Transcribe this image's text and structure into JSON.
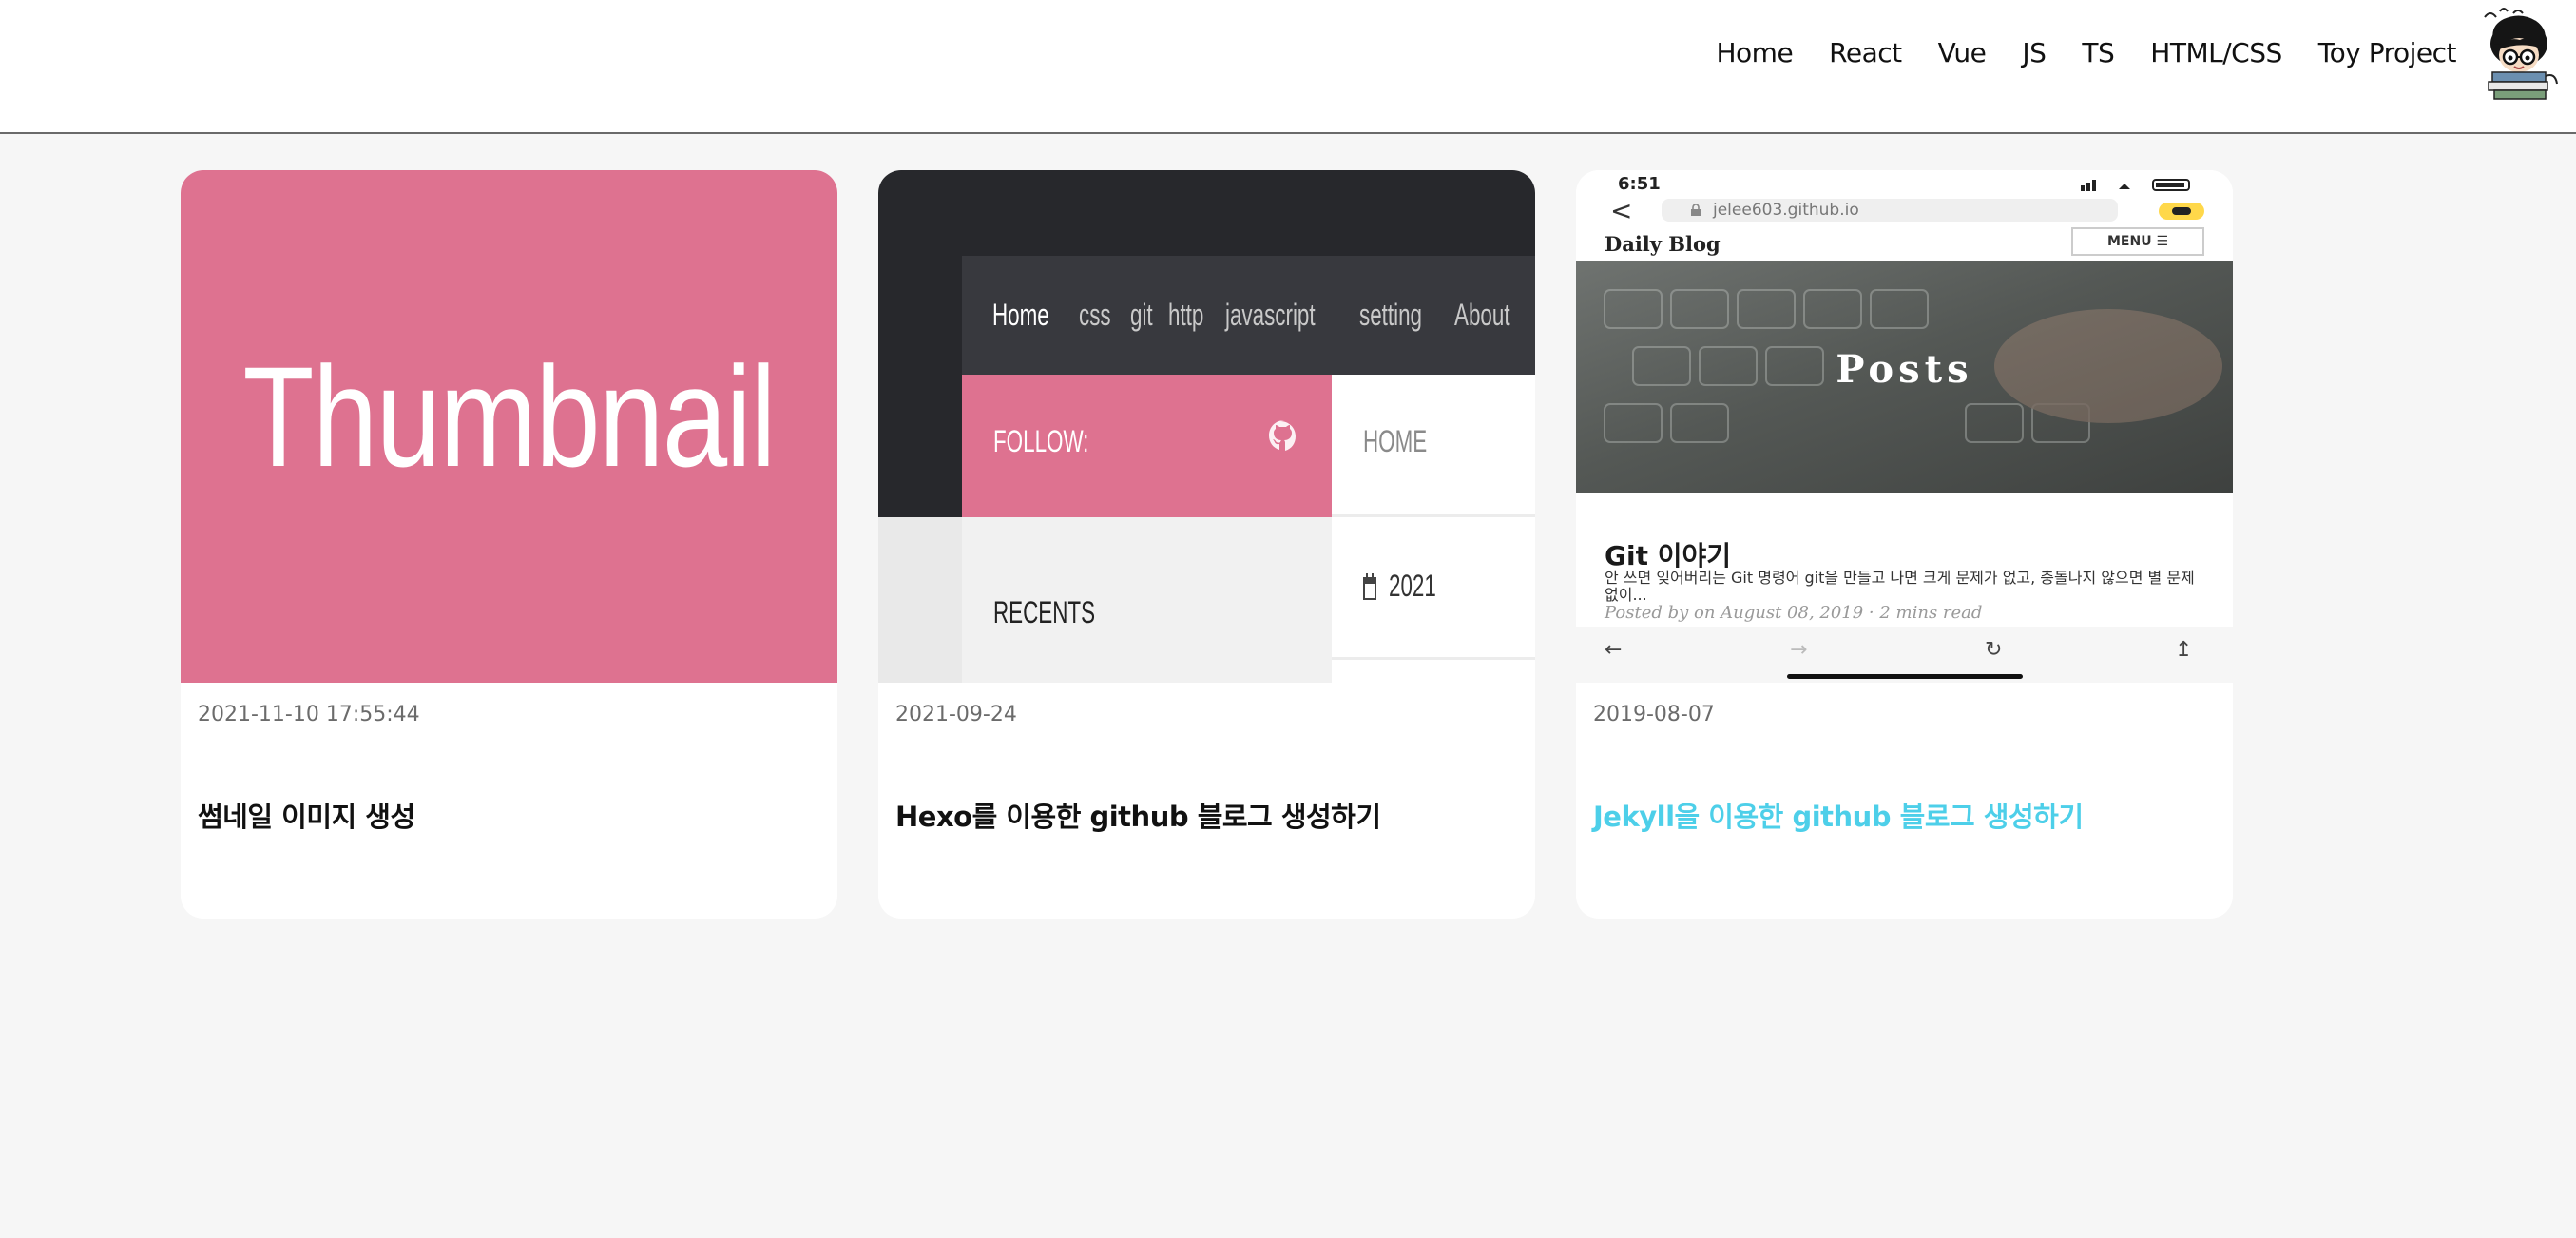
{
  "header": {
    "nav": [
      "Home",
      "React",
      "Vue",
      "JS",
      "TS",
      "HTML/CSS",
      "Toy Project"
    ],
    "avatar_icon": "cartoon-avatar-icon"
  },
  "accent_color": "#4dcfe9",
  "cards": [
    {
      "date": "2021-11-10 17:55:44",
      "title": "썸네일 이미지 생성",
      "thumbnail": {
        "background": "#de7290",
        "text": "Thumbnail"
      }
    },
    {
      "date": "2021-09-24",
      "title": "Hexo를 이용한 github 블로그 생성하기",
      "thumbnail": {
        "nav": [
          "Home",
          "css",
          "git",
          "http",
          "javascript",
          "setting",
          "About"
        ],
        "follow_label": "FOLLOW:",
        "home_label": "HOME",
        "recents_label": "RECENTS",
        "year_label": "2021"
      }
    },
    {
      "date": "2019-08-07",
      "title": "Jekyll을 이용한 github 블로그 생성하기",
      "thumbnail": {
        "status_time": "6:51",
        "url": "jelee603.github.io",
        "blog_title": "Daily Blog",
        "menu_label": "MENU ☰",
        "hero_text": "Posts",
        "post_title": "Git 이야기",
        "post_excerpt": "안 쓰면 잊어버리는 Git 명령어 git을 만들고 나면 크게 문제가 없고, 충돌나지 않으면 별 문제없이...",
        "post_meta": "Posted by on August 08, 2019 · 2 mins read"
      }
    }
  ]
}
